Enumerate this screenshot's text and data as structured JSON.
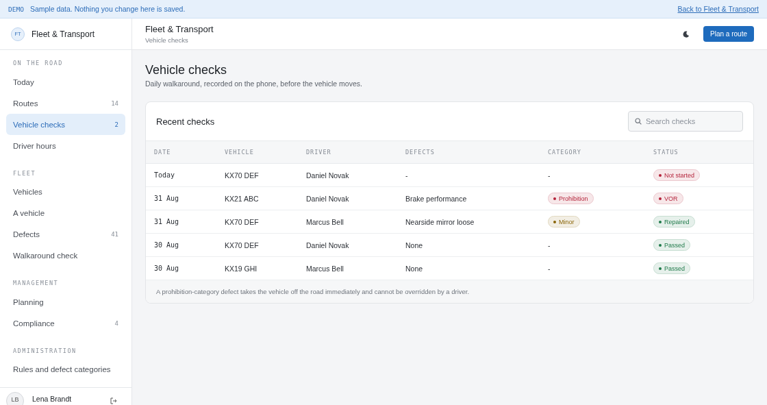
{
  "banner": {
    "tag": "DEMO",
    "message": "Sample data. Nothing you change here is saved.",
    "link": "Back to Fleet & Transport"
  },
  "sidebar": {
    "brand": {
      "initials": "FT",
      "name": "Fleet & Transport"
    },
    "sections": [
      {
        "title": "ON THE ROAD",
        "items": [
          {
            "label": "Today",
            "selected": false
          },
          {
            "label": "Routes",
            "count": "14",
            "selected": false
          },
          {
            "label": "Vehicle checks",
            "count": "2",
            "selected": true
          },
          {
            "label": "Driver hours",
            "selected": false
          }
        ]
      },
      {
        "title": "FLEET",
        "items": [
          {
            "label": "Vehicles",
            "selected": false
          },
          {
            "label": "A vehicle",
            "selected": false
          },
          {
            "label": "Defects",
            "count": "41",
            "selected": false
          },
          {
            "label": "Walkaround check",
            "selected": false
          }
        ]
      },
      {
        "title": "MANAGEMENT",
        "items": [
          {
            "label": "Planning",
            "selected": false
          },
          {
            "label": "Compliance",
            "count": "4",
            "selected": false
          }
        ]
      },
      {
        "title": "ADMINISTRATION",
        "items": [
          {
            "label": "Rules and defect categories",
            "selected": false
          }
        ]
      }
    ],
    "user": {
      "initials": "LB",
      "name": "Lena Brandt"
    }
  },
  "header": {
    "title": "Fleet & Transport",
    "breadcrumb": "Vehicle checks",
    "button": "Plan a route"
  },
  "page": {
    "title": "Vehicle checks",
    "subtitle": "Daily walkaround, recorded on the phone, before the vehicle moves."
  },
  "card": {
    "title": "Recent checks",
    "search": {
      "placeholder": "Search checks"
    },
    "table": {
      "columns": [
        "DATE",
        "VEHICLE",
        "DRIVER",
        "DEFECTS",
        "CATEGORY",
        "STATUS"
      ],
      "rows": [
        {
          "date": "Today",
          "vehicle": "KX70 DEF",
          "driver": "Daniel Novak",
          "defects": "-",
          "category": {
            "text": "-"
          },
          "status": {
            "text": "Not started",
            "color": "#b4233a"
          }
        },
        {
          "date": "31 Aug",
          "vehicle": "KX21 ABC",
          "driver": "Daniel Novak",
          "defects": "Brake performance",
          "category": {
            "text": "Prohibition",
            "color": "#b4233a"
          },
          "status": {
            "text": "VOR",
            "color": "#b4233a"
          }
        },
        {
          "date": "31 Aug",
          "vehicle": "KX70 DEF",
          "driver": "Marcus Bell",
          "defects": "Nearside mirror loose",
          "category": {
            "text": "Minor",
            "color": "#8a6508"
          },
          "status": {
            "text": "Repaired",
            "color": "#1f7a4a"
          }
        },
        {
          "date": "30 Aug",
          "vehicle": "KX70 DEF",
          "driver": "Daniel Novak",
          "defects": "None",
          "category": {
            "text": "-"
          },
          "status": {
            "text": "Passed",
            "color": "#1f7a4a"
          }
        },
        {
          "date": "30 Aug",
          "vehicle": "KX19 GHI",
          "driver": "Marcus Bell",
          "defects": "None",
          "category": {
            "text": "-"
          },
          "status": {
            "text": "Passed",
            "color": "#1f7a4a"
          }
        }
      ]
    },
    "footnote": "A prohibition-category defect takes the vehicle off the road immediately and cannot be overridden by a driver."
  }
}
